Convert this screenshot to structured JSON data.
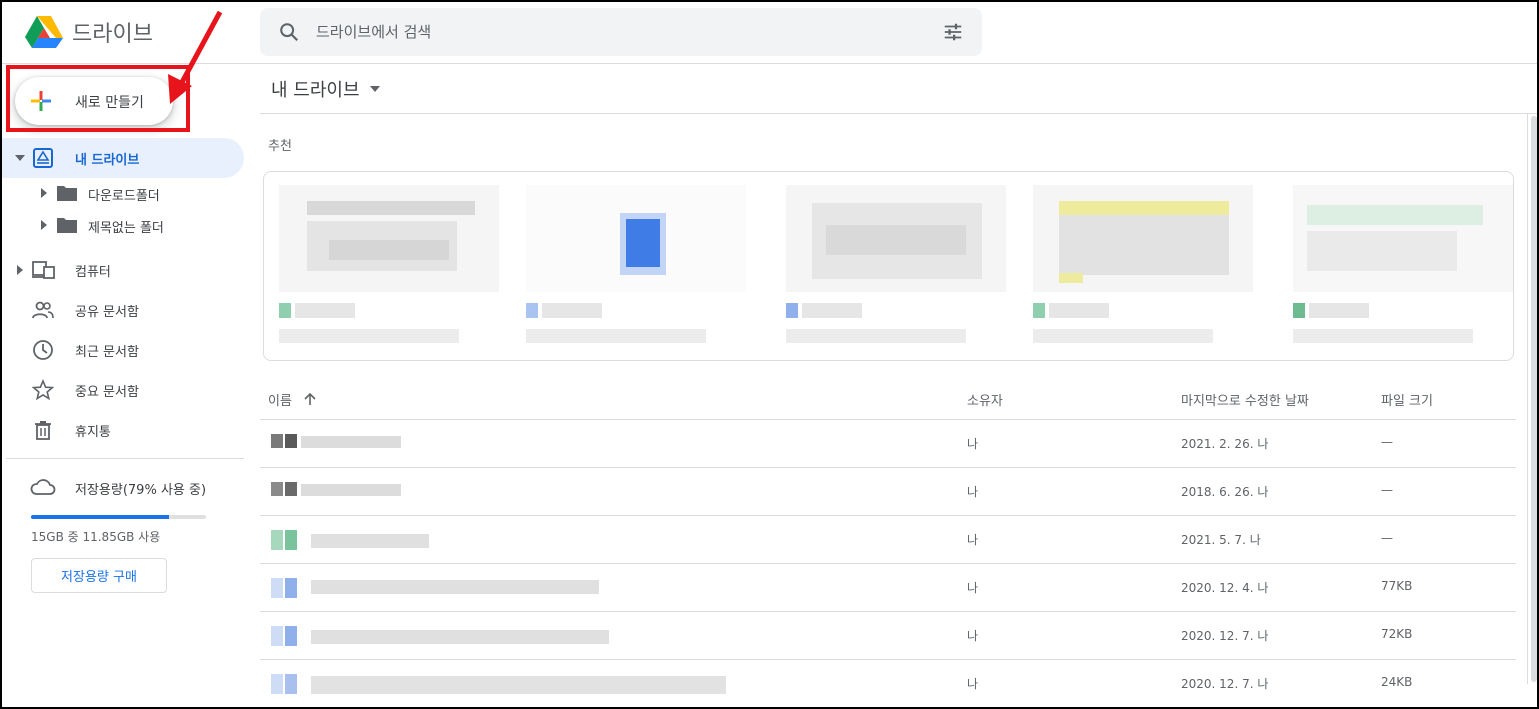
{
  "app": {
    "title": "드라이브"
  },
  "search": {
    "placeholder": "드라이브에서 검색"
  },
  "sidebar": {
    "new_label": "새로 만들기",
    "my_drive": "내 드라이브",
    "folders": [
      "다운로드폴더",
      "제목없는 폴더"
    ],
    "computers": "컴퓨터",
    "shared": "공유 문서함",
    "recent": "최근 문서함",
    "starred": "중요 문서함",
    "trash": "휴지통",
    "storage_label": "저장용량(79% 사용 중)",
    "storage_used_fraction": 0.79,
    "storage_detail": "15GB 중 11.85GB 사용",
    "buy_storage": "저장용량 구매"
  },
  "main": {
    "breadcrumb": "내 드라이브",
    "suggested_label": "추천",
    "columns": {
      "name": "이름",
      "owner": "소유자",
      "modified": "마지막으로 수정한 날짜",
      "size": "파일 크기"
    },
    "files": [
      {
        "owner": "나",
        "modified": "2021. 2. 26. 나",
        "size": "—"
      },
      {
        "owner": "나",
        "modified": "2018. 6. 26. 나",
        "size": "—"
      },
      {
        "owner": "나",
        "modified": "2021. 5. 7. 나",
        "size": "—"
      },
      {
        "owner": "나",
        "modified": "2020. 12. 4. 나",
        "size": "77KB"
      },
      {
        "owner": "나",
        "modified": "2020. 12. 7. 나",
        "size": "72KB"
      },
      {
        "owner": "나",
        "modified": "2020. 12. 7. 나",
        "size": "24KB"
      }
    ]
  },
  "colors": {
    "accent": "#1a73e8",
    "annotation": "#e8141b",
    "active_bg": "#e8f0fe"
  }
}
